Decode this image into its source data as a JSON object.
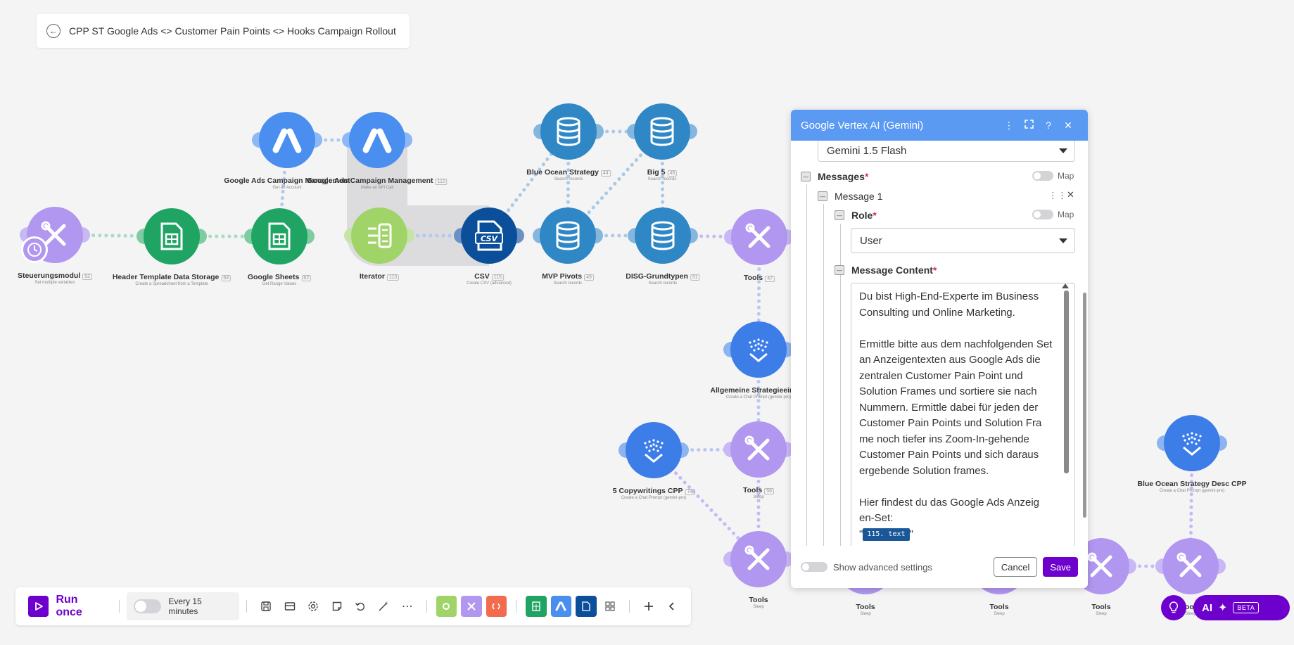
{
  "scenario": {
    "title": "CPP ST Google Ads <> Customer Pain Points <> Hooks Campaign Rollout"
  },
  "nodes": [
    {
      "id": "steuerung",
      "label": "Steuerungsmodul",
      "badge": "52",
      "sub": "Set multiple variables"
    },
    {
      "id": "header",
      "label": "Header Template Data Storage",
      "badge": "64",
      "sub": "Create a Spreadsheet from a Template"
    },
    {
      "id": "gsheets",
      "label": "Google Sheets",
      "badge": "62",
      "sub": "Get Range Values"
    },
    {
      "id": "gads1",
      "label": "Google Ads Campaign Management",
      "badge": "",
      "sub": "Get an Account"
    },
    {
      "id": "gads2",
      "label": "Google Ads Campaign Management",
      "badge": "112",
      "sub": "Make an API Call"
    },
    {
      "id": "iterator",
      "label": "Iterator",
      "badge": "113",
      "sub": ""
    },
    {
      "id": "csv",
      "label": "CSV",
      "badge": "115",
      "sub": "Create CSV (advanced)"
    },
    {
      "id": "blueocean",
      "label": "Blue Ocean Strategy",
      "badge": "44",
      "sub": "Search records"
    },
    {
      "id": "big5",
      "label": "Big 5",
      "badge": "45",
      "sub": "Search records"
    },
    {
      "id": "mvp",
      "label": "MVP Pivots",
      "badge": "49",
      "sub": "Search records"
    },
    {
      "id": "disg",
      "label": "DISG-Grundtypen",
      "badge": "51",
      "sub": "Search records"
    },
    {
      "id": "tools1",
      "label": "Tools",
      "badge": "47",
      "sub": ""
    },
    {
      "id": "allg",
      "label": "Allgemeine Strategieeinsch",
      "badge": "",
      "sub": "Create a Chat Prompt (gemini-pro)"
    },
    {
      "id": "copy5",
      "label": "5 Copywritings CPP",
      "badge": "74",
      "sub": "Create a Chat Prompt (gemini-pro)"
    },
    {
      "id": "tools2",
      "label": "Tools",
      "badge": "56",
      "sub": "Sleep"
    },
    {
      "id": "tools3",
      "label": "Tools",
      "badge": "",
      "sub": "Sleep"
    },
    {
      "id": "tools4",
      "label": "Tools",
      "badge": "",
      "sub": "Sleep"
    },
    {
      "id": "tools5",
      "label": "Tools",
      "badge": "",
      "sub": "Sleep"
    },
    {
      "id": "tools6",
      "label": "Tools",
      "badge": "",
      "sub": "Sleep"
    },
    {
      "id": "tools7",
      "label": "Tools",
      "badge": "",
      "sub": "Sleep"
    },
    {
      "id": "bocpp",
      "label": "Blue Ocean Strategy Desc CPP",
      "badge": "",
      "sub": "Create a Chat Prompt (gemini-pro)"
    }
  ],
  "colors": {
    "purple": "#6d00cc",
    "tools": "#b197f0",
    "sheets": "#1fa463",
    "ads": "#4a8ef0",
    "db": "#2f87c5",
    "iterator": "#a0d468",
    "csv": "#0b4f9a",
    "gemini": "#3d7de8",
    "panel_header": "#5a9af2"
  },
  "panel": {
    "title": "Google Vertex AI (Gemini)",
    "model_value": "Gemini 1.5 Flash",
    "messages_label": "Messages",
    "map_label": "Map",
    "message1_label": "Message 1",
    "role_label": "Role",
    "role_value": "User",
    "content_label": "Message Content",
    "content_p1": "Du bist High-End-Experte im Business Consulting und Online Marketing.",
    "content_p2": "Ermittle bitte aus dem nachfolgenden Set an Anzeigentexten aus Google Ads die zentralen Customer Pain Point und Solution Frames und sortiere sie nach Nummern. Ermittle dabei für jeden der Customer Pain Points und Solution Fra me noch tiefer ins Zoom-In-gehende Customer Pain Points und sich daraus ergebende Solution frames.",
    "content_p3": "Hier findest du das Google Ads Anzeig en-Set:",
    "pill": "115. text",
    "quote": "\"",
    "advanced_label": "Show advanced settings",
    "cancel_label": "Cancel",
    "save_label": "Save"
  },
  "toolbar": {
    "run_once_label": "Run once",
    "schedule_label": "Every 15 minutes"
  },
  "ai": {
    "ai_label": "AI",
    "beta_label": "BETA"
  }
}
